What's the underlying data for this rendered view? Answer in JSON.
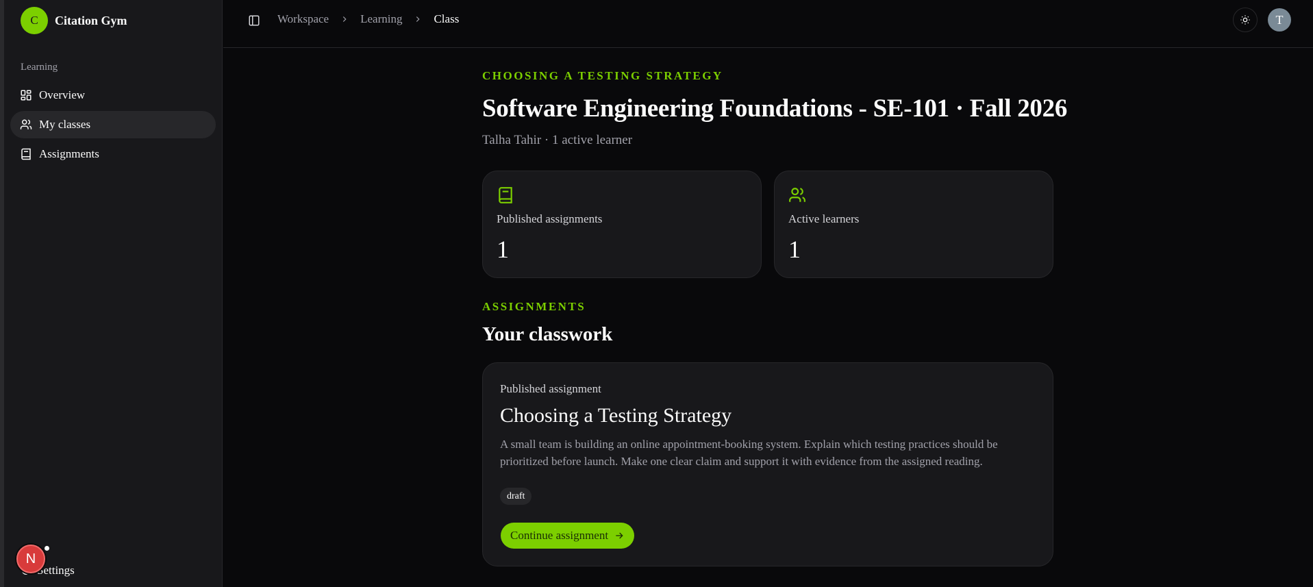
{
  "brand": {
    "initial": "C",
    "name": "Citation Gym"
  },
  "sidebar": {
    "group_label": "Learning",
    "items": [
      {
        "label": "Overview",
        "icon": "dashboard-icon",
        "active": false
      },
      {
        "label": "My classes",
        "icon": "users-icon",
        "active": true
      },
      {
        "label": "Assignments",
        "icon": "book-icon",
        "active": false
      }
    ],
    "settings_label": "Settings",
    "fab_letter": "N"
  },
  "breadcrumb": [
    "Workspace",
    "Learning",
    "Class"
  ],
  "user": {
    "avatar_initial": "T"
  },
  "header": {
    "eyebrow": "CHOOSING A TESTING STRATEGY",
    "title": "Software Engineering Foundations - SE-101 · Fall 2026",
    "subline": "Talha Tahir · 1 active learner"
  },
  "stats": [
    {
      "label": "Published assignments",
      "value": "1",
      "icon": "book-icon"
    },
    {
      "label": "Active learners",
      "value": "1",
      "icon": "users-icon"
    }
  ],
  "assignments_section": {
    "eyebrow": "ASSIGNMENTS",
    "title": "Your classwork"
  },
  "assignment": {
    "kicker": "Published assignment",
    "title": "Choosing a Testing Strategy",
    "description": "A small team is building an online appointment-booking system. Explain which testing practices should be prioritized before launch. Make one clear claim and support it with evidence from the assigned reading.",
    "status": "draft",
    "cta_label": "Continue assignment"
  },
  "colors": {
    "accent": "#7ccf00",
    "background": "#09090b",
    "card": "#18181b",
    "fab": "#d83b3b"
  }
}
